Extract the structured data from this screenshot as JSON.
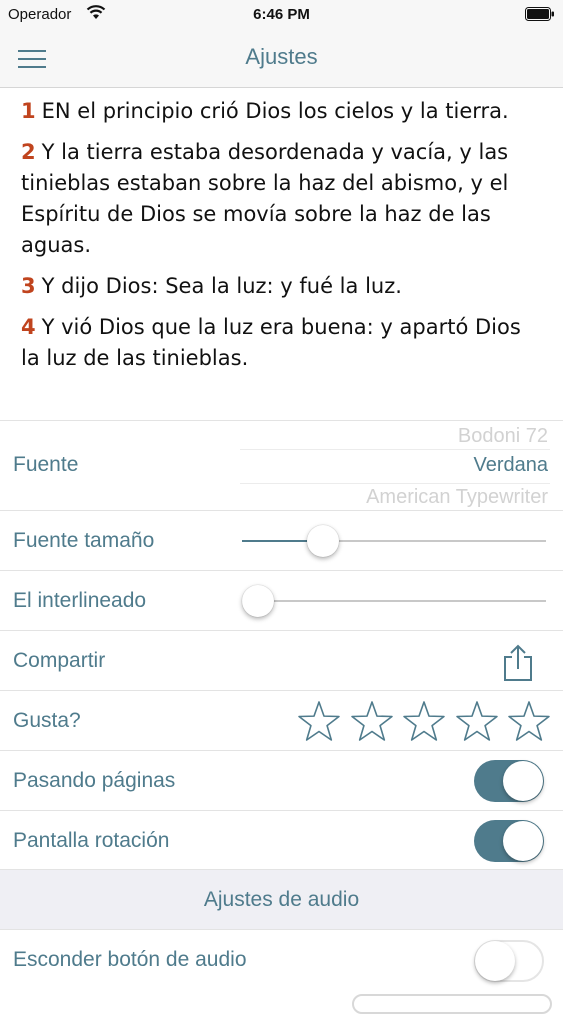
{
  "status_bar": {
    "carrier": "Operador",
    "time": "6:46 PM"
  },
  "nav": {
    "title": "Ajustes"
  },
  "preview": {
    "verses": [
      {
        "num": "1",
        "text": "EN el principio crió Dios los cielos y la tierra."
      },
      {
        "num": "2",
        "text": "Y la tierra estaba desordenada y vacía, y las tinieblas estaban sobre la haz del abismo, y el Espíritu de Dios se movía sobre la haz de las aguas."
      },
      {
        "num": "3",
        "text": "Y dijo Dios: Sea la luz: y fué la luz."
      },
      {
        "num": "4",
        "text": "Y vió Dios que la luz era buena: y apartó Dios la luz de las tinieblas."
      }
    ]
  },
  "settings": {
    "font": {
      "label": "Fuente",
      "option_above": "Bodoni 72",
      "selected": "Verdana",
      "option_below": "American Typewriter"
    },
    "font_size": {
      "label": "Fuente tamaño",
      "value_fraction": 0.24
    },
    "line_spacing": {
      "label": "El interlineado",
      "value_fraction": 0.0
    },
    "share": {
      "label": "Compartir"
    },
    "rating": {
      "label": "Gusta?",
      "stars_filled": 0,
      "stars_total": 5
    },
    "page_turning": {
      "label": "Pasando páginas",
      "on": true
    },
    "screen_rotation": {
      "label": "Pantalla rotación",
      "on": true
    }
  },
  "audio_section": {
    "title": "Ajustes de audio",
    "hide_audio_button": {
      "label": "Esconder botón de audio",
      "on": false
    }
  },
  "colors": {
    "accent": "#4f7b8c",
    "verse_number": "#c0441e"
  },
  "icons": [
    "wifi-icon",
    "battery-icon",
    "hamburger-menu-icon",
    "share-icon",
    "star-outline-icon"
  ]
}
